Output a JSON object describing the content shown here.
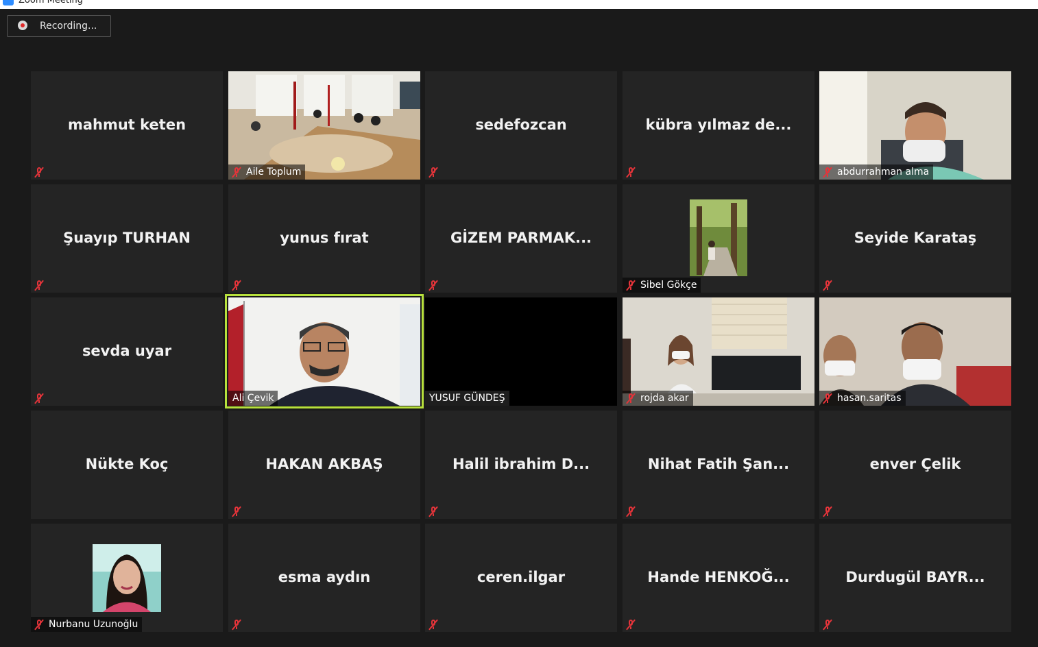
{
  "window": {
    "title": "Zoom Meeting"
  },
  "recording": {
    "label": "Recording..."
  },
  "participants": [
    {
      "name": "mahmut keten",
      "footer": ""
    },
    {
      "name": "",
      "footer": "Aile Toplum"
    },
    {
      "name": "sedefozcan",
      "footer": ""
    },
    {
      "name": "kübra yılmaz de...",
      "footer": ""
    },
    {
      "name": "",
      "footer": "abdurrahman alma"
    },
    {
      "name": "Şuayıp TURHAN",
      "footer": ""
    },
    {
      "name": "yunus fırat",
      "footer": ""
    },
    {
      "name": "GİZEM  PARMAK...",
      "footer": ""
    },
    {
      "name": "",
      "footer": "Sibel Gökçe"
    },
    {
      "name": "Seyide Karataş",
      "footer": ""
    },
    {
      "name": "sevda uyar",
      "footer": ""
    },
    {
      "name": "",
      "footer": "Ali Çevik"
    },
    {
      "name": "",
      "footer": "YUSUF GÜNDEŞ"
    },
    {
      "name": "",
      "footer": "rojda akar"
    },
    {
      "name": "",
      "footer": "hasan.saritas"
    },
    {
      "name": "Nükte Koç",
      "footer": ""
    },
    {
      "name": "HAKAN AKBAŞ",
      "footer": ""
    },
    {
      "name": "Halil  ibrahim  D...",
      "footer": ""
    },
    {
      "name": "Nihat  Fatih  Şan...",
      "footer": ""
    },
    {
      "name": "enver Çelik",
      "footer": ""
    },
    {
      "name": "",
      "footer": "Nurbanu Uzunoğlu"
    },
    {
      "name": "esma aydın",
      "footer": ""
    },
    {
      "name": "ceren.ilgar",
      "footer": ""
    },
    {
      "name": "Hande  HENKOĞ...",
      "footer": ""
    },
    {
      "name": "Durdugül  BAYR...",
      "footer": ""
    }
  ],
  "colors": {
    "active_speaker_border": "#b7e03c",
    "muted_icon": "#e5343a",
    "tile_bg": "#242424"
  }
}
